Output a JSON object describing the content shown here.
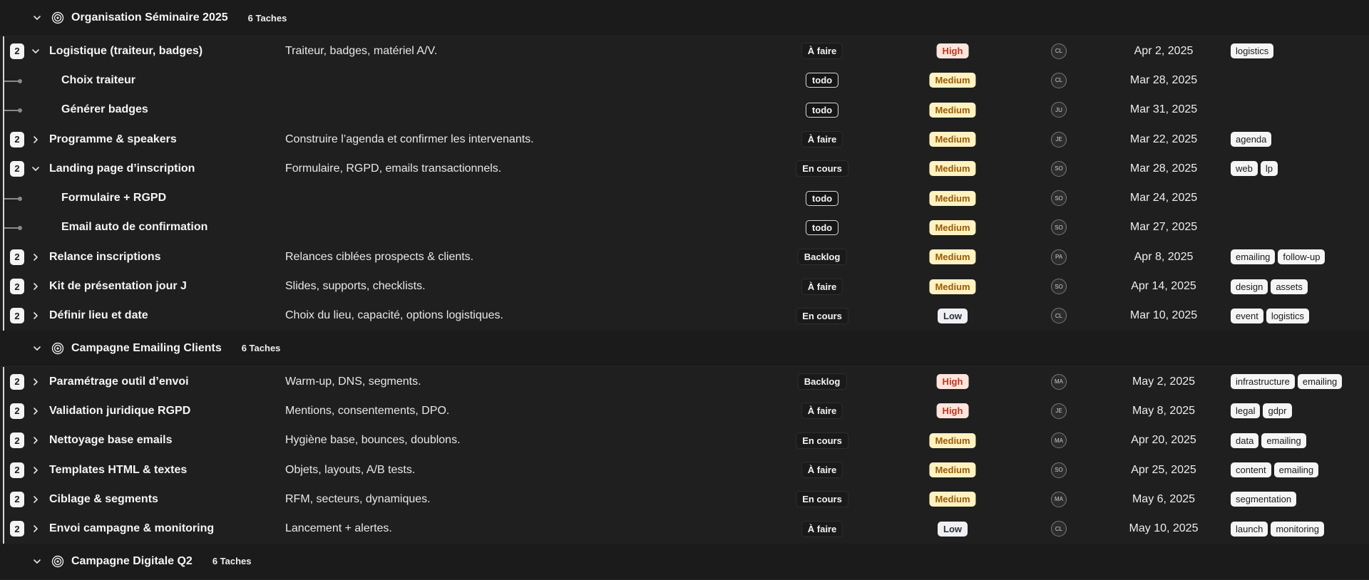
{
  "groups": [
    {
      "title": "Organisation Séminaire 2025",
      "count": "6 Taches",
      "rows": [
        {
          "type": "task",
          "count": "2",
          "expanded": true,
          "title": "Logistique (traiteur, badges)",
          "desc": "Traiteur, badges, matériel A/V.",
          "status": "À faire",
          "priority": "High",
          "avatar": "CL",
          "date": "Apr 2, 2025",
          "tags": [
            "logistics"
          ]
        },
        {
          "type": "sub",
          "title": "Choix traiteur",
          "desc": "",
          "status": "todo",
          "priority": "Medium",
          "avatar": "CL",
          "date": "Mar 28, 2025",
          "tags": []
        },
        {
          "type": "sub",
          "title": "Générer badges",
          "desc": "",
          "status": "todo",
          "priority": "Medium",
          "avatar": "JU",
          "date": "Mar 31, 2025",
          "tags": []
        },
        {
          "type": "task",
          "count": "2",
          "expanded": false,
          "title": "Programme & speakers",
          "desc": "Construire l’agenda et confirmer les intervenants.",
          "status": "À faire",
          "priority": "Medium",
          "avatar": "JE",
          "date": "Mar 22, 2025",
          "tags": [
            "agenda"
          ]
        },
        {
          "type": "task",
          "count": "2",
          "expanded": true,
          "title": "Landing page d’inscription",
          "desc": "Formulaire, RGPD, emails transactionnels.",
          "status": "En cours",
          "priority": "Medium",
          "avatar": "SO",
          "date": "Mar 28, 2025",
          "tags": [
            "web",
            "lp"
          ]
        },
        {
          "type": "sub",
          "title": "Formulaire + RGPD",
          "desc": "",
          "status": "todo",
          "priority": "Medium",
          "avatar": "SO",
          "date": "Mar 24, 2025",
          "tags": []
        },
        {
          "type": "sub",
          "title": "Email auto de confirmation",
          "desc": "",
          "status": "todo",
          "priority": "Medium",
          "avatar": "SO",
          "date": "Mar 27, 2025",
          "tags": []
        },
        {
          "type": "task",
          "count": "2",
          "expanded": false,
          "title": "Relance inscriptions",
          "desc": "Relances ciblées prospects & clients.",
          "status": "Backlog",
          "priority": "Medium",
          "avatar": "PA",
          "date": "Apr 8, 2025",
          "tags": [
            "emailing",
            "follow-up"
          ]
        },
        {
          "type": "task",
          "count": "2",
          "expanded": false,
          "title": "Kit de présentation jour J",
          "desc": "Slides, supports, checklists.",
          "status": "À faire",
          "priority": "Medium",
          "avatar": "SO",
          "date": "Apr 14, 2025",
          "tags": [
            "design",
            "assets"
          ]
        },
        {
          "type": "task",
          "count": "2",
          "expanded": false,
          "title": "Définir lieu et date",
          "desc": "Choix du lieu, capacité, options logistiques.",
          "status": "En cours",
          "priority": "Low",
          "avatar": "CL",
          "date": "Mar 10, 2025",
          "tags": [
            "event",
            "logistics"
          ]
        }
      ]
    },
    {
      "title": "Campagne Emailing Clients",
      "count": "6 Taches",
      "rows": [
        {
          "type": "task",
          "count": "2",
          "expanded": false,
          "title": "Paramétrage outil d’envoi",
          "desc": "Warm-up, DNS, segments.",
          "status": "Backlog",
          "priority": "High",
          "avatar": "MA",
          "date": "May 2, 2025",
          "tags": [
            "infrastructure",
            "emailing"
          ]
        },
        {
          "type": "task",
          "count": "2",
          "expanded": false,
          "title": "Validation juridique RGPD",
          "desc": "Mentions, consentements, DPO.",
          "status": "À faire",
          "priority": "High",
          "avatar": "JE",
          "date": "May 8, 2025",
          "tags": [
            "legal",
            "gdpr"
          ]
        },
        {
          "type": "task",
          "count": "2",
          "expanded": false,
          "title": "Nettoyage base emails",
          "desc": "Hygiène base, bounces, doublons.",
          "status": "En cours",
          "priority": "Medium",
          "avatar": "MA",
          "date": "Apr 20, 2025",
          "tags": [
            "data",
            "emailing"
          ]
        },
        {
          "type": "task",
          "count": "2",
          "expanded": false,
          "title": "Templates HTML & textes",
          "desc": "Objets, layouts, A/B tests.",
          "status": "À faire",
          "priority": "Medium",
          "avatar": "SO",
          "date": "Apr 25, 2025",
          "tags": [
            "content",
            "emailing"
          ]
        },
        {
          "type": "task",
          "count": "2",
          "expanded": false,
          "title": "Ciblage & segments",
          "desc": "RFM, secteurs, dynamiques.",
          "status": "En cours",
          "priority": "Medium",
          "avatar": "MA",
          "date": "May 6, 2025",
          "tags": [
            "segmentation"
          ]
        },
        {
          "type": "task",
          "count": "2",
          "expanded": false,
          "title": "Envoi campagne & monitoring",
          "desc": "Lancement + alertes.",
          "status": "À faire",
          "priority": "Low",
          "avatar": "CL",
          "date": "May 10, 2025",
          "tags": [
            "launch",
            "monitoring"
          ]
        }
      ]
    },
    {
      "title": "Campagne Digitale Q2",
      "count": "6 Taches",
      "rows": []
    }
  ]
}
